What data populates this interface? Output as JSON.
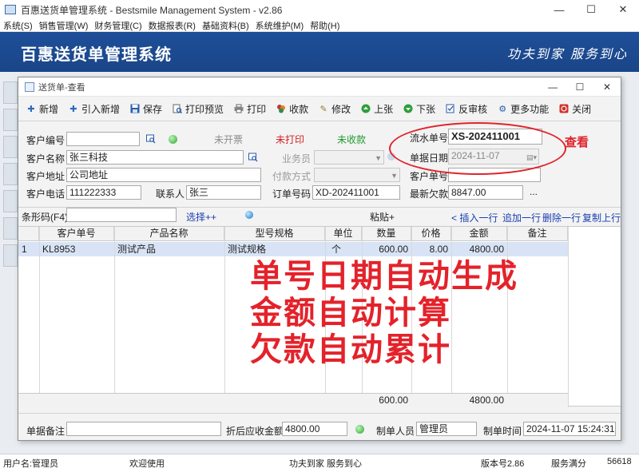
{
  "window": {
    "title": "百惠送货单管理系统 - Bestsmile Management System - v2.86",
    "minimize": "—",
    "maximize": "☐",
    "close": "✕"
  },
  "menu": [
    "系统(S)",
    "销售管理(W)",
    "财务管理(C)",
    "数据报表(R)",
    "基础资料(B)",
    "系统维护(M)",
    "帮助(H)"
  ],
  "banner": {
    "title": "百惠送货单管理系统",
    "slogan": "功夫到家  服务到心"
  },
  "child": {
    "title": "送货单-查看",
    "minimize": "—",
    "maximize": "☐",
    "close": "✕"
  },
  "toolbar": [
    {
      "label": "新增",
      "icon": "plus-icon",
      "color": "#2b6cc4"
    },
    {
      "label": "引入新增",
      "icon": "plus-icon",
      "color": "#2b6cc4"
    },
    {
      "label": "保存",
      "icon": "save-icon",
      "color": "#2a5ca8"
    },
    {
      "label": "打印预览",
      "icon": "print-preview-icon",
      "color": "#555555"
    },
    {
      "label": "打印",
      "icon": "printer-icon",
      "color": "#555555"
    },
    {
      "label": "收款",
      "icon": "money-icon",
      "color": "#c0392b"
    },
    {
      "label": "修改",
      "icon": "edit-icon",
      "color": "#a0782a"
    },
    {
      "label": "上张",
      "icon": "arrow-up-icon",
      "color": "#2e9e3a"
    },
    {
      "label": "下张",
      "icon": "arrow-down-icon",
      "color": "#2e9e3a"
    },
    {
      "label": "反审核",
      "icon": "unaudit-icon",
      "color": "#2a5ca8"
    },
    {
      "label": "更多功能",
      "icon": "gear-icon",
      "color": "#2a5ca8"
    },
    {
      "label": "关闭",
      "icon": "close-icon",
      "color": "#d0302b"
    }
  ],
  "form": {
    "customer_code_label": "客户编号",
    "customer_code_value": "",
    "status_invoice": "未开票",
    "status_print": "未打印",
    "status_pay": "未收款",
    "serial_label": "流水单号",
    "serial_value": "XS-202411001",
    "customer_name_label": "客户名称",
    "customer_name_value": "张三科技",
    "salesman_label": "业务员",
    "salesman_value": "",
    "date_label": "单据日期",
    "date_value": "2024-11-07",
    "address_label": "客户地址",
    "address_value": "公司地址",
    "paymethod_label": "付款方式",
    "paymethod_value": "",
    "customer_no_label": "客户单号",
    "customer_no_value": "",
    "phone_label": "客户电话",
    "phone_value": "111222333",
    "contact_label": "联系人",
    "contact_value": "张三",
    "order_no_label": "订单号码",
    "order_no_value": "XD-202411001",
    "debt_label": "最新欠款",
    "debt_value": "8847.00",
    "more": "..."
  },
  "annotation_view": "查看",
  "barcode": {
    "label": "条形码(F4)",
    "value": "",
    "select": "选择++",
    "paste": "粘贴+",
    "insert_row": "< 插入一行",
    "append_row": "追加一行",
    "delete_row": "删除一行",
    "copy_row": "复制上行"
  },
  "grid": {
    "columns": [
      "客户单号",
      "产品名称",
      "型号规格",
      "单位",
      "数量",
      "价格",
      "金额",
      "备注"
    ],
    "rows": [
      {
        "idx": "1",
        "cust_no": "KL8953",
        "product": "测试产品",
        "spec": "测试规格",
        "unit": "个",
        "qty": "600.00",
        "price": "8.00",
        "amount": "4800.00",
        "note": ""
      }
    ],
    "total_qty": "600.00",
    "total_amount": "4800.00"
  },
  "annotation_lines": [
    "单号日期自动生成",
    "金额自动计算",
    "欠款自动累计"
  ],
  "bottom": {
    "note_label": "单据备注",
    "note_value": "",
    "net_label": "折后应收金额",
    "net_value": "4800.00",
    "maker_label": "制单人员",
    "maker_value": "管理员",
    "time_label": "制单时间",
    "time_value": "2024-11-07 15:24:31"
  },
  "status": {
    "user": "用户名:管理员",
    "welcome": "欢迎使用",
    "slogan": "功夫到家 服务到心",
    "version": "版本号2.86",
    "service": "服务满分",
    "code": "56618"
  }
}
